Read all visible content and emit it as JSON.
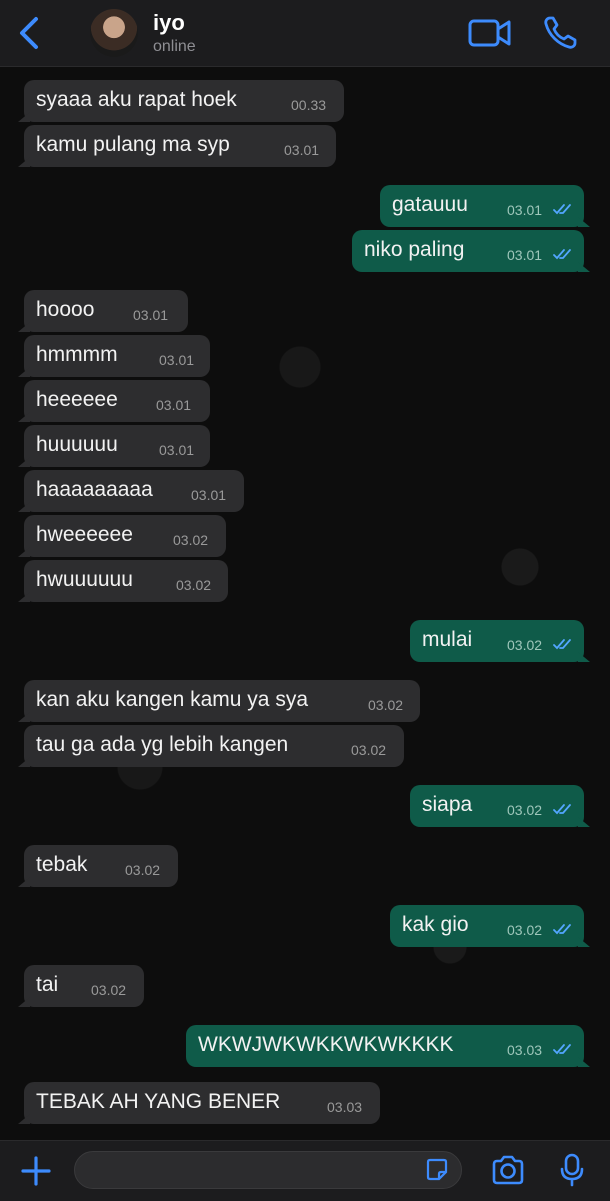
{
  "header": {
    "contact_name": "iyo",
    "contact_status": "online"
  },
  "messages": [
    {
      "dir": "in",
      "text": "syaaa aku rapat hoek",
      "time": "00.33"
    },
    {
      "dir": "in",
      "text": "kamu pulang ma syp",
      "time": "03.01"
    },
    {
      "dir": "out",
      "text": "gatauuu",
      "time": "03.01",
      "status": "read"
    },
    {
      "dir": "out",
      "text": "niko paling",
      "time": "03.01",
      "status": "read"
    },
    {
      "dir": "in",
      "text": "hoooo",
      "time": "03.01"
    },
    {
      "dir": "in",
      "text": "hmmmm",
      "time": "03.01"
    },
    {
      "dir": "in",
      "text": "heeeeee",
      "time": "03.01"
    },
    {
      "dir": "in",
      "text": "huuuuuu",
      "time": "03.01"
    },
    {
      "dir": "in",
      "text": "haaaaaaaaa",
      "time": "03.01"
    },
    {
      "dir": "in",
      "text": "hweeeeee",
      "time": "03.02"
    },
    {
      "dir": "in",
      "text": "hwuuuuuu",
      "time": "03.02"
    },
    {
      "dir": "out",
      "text": "mulai",
      "time": "03.02",
      "status": "read"
    },
    {
      "dir": "in",
      "text": "kan aku kangen kamu ya sya",
      "time": "03.02"
    },
    {
      "dir": "in",
      "text": "tau ga ada yg lebih kangen",
      "time": "03.02"
    },
    {
      "dir": "out",
      "text": "siapa",
      "time": "03.02",
      "status": "read"
    },
    {
      "dir": "in",
      "text": "tebak",
      "time": "03.02"
    },
    {
      "dir": "out",
      "text": "kak gio",
      "time": "03.02",
      "status": "read"
    },
    {
      "dir": "in",
      "text": "tai",
      "time": "03.02"
    },
    {
      "dir": "out",
      "text": "WKWJWKWKKWKWKKKK",
      "time": "03.03",
      "status": "read"
    },
    {
      "dir": "in",
      "text": "TEBAK AH YANG BENER",
      "time": "03.03"
    }
  ],
  "composer": {
    "input_value": "",
    "icons": [
      "plus-icon",
      "sticker-icon",
      "camera-icon",
      "microphone-icon"
    ]
  },
  "colors": {
    "accent": "#3d8bfd",
    "incoming_bubble": "#2d2d2f",
    "outgoing_bubble": "#0f5b49",
    "read_ticks": "#53a6ff"
  }
}
